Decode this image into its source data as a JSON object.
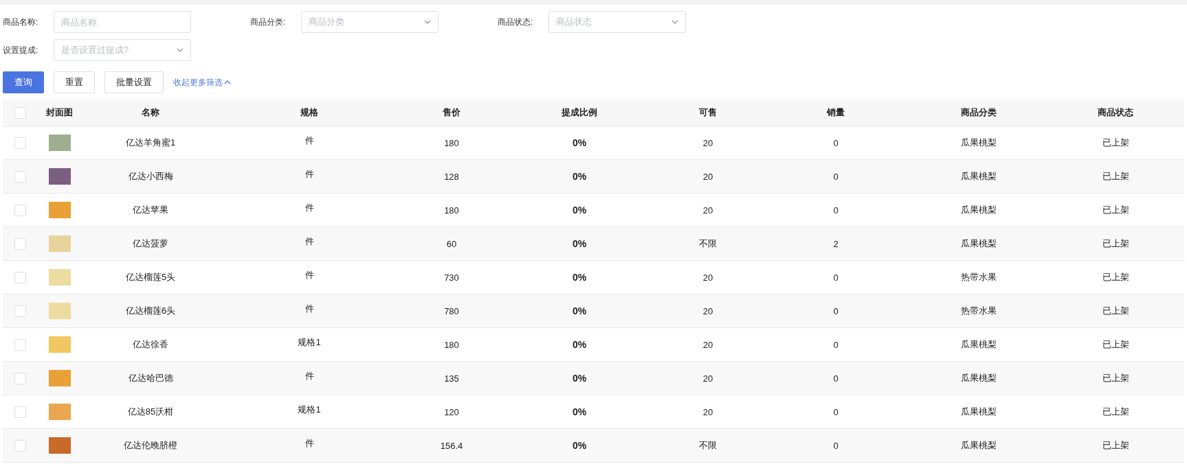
{
  "filters": [
    {
      "kind": "text",
      "label": "商品名称:",
      "placeholder": "商品名称"
    },
    {
      "kind": "select",
      "label": "商品分类:",
      "placeholder": "商品分类"
    },
    {
      "kind": "select",
      "label": "商品状态:",
      "placeholder": "商品状态"
    },
    {
      "kind": "select",
      "label": "设置提成:",
      "placeholder": "是否设置过提成?"
    }
  ],
  "actions": [
    {
      "kind": "primary",
      "label": "查询"
    },
    {
      "kind": "default",
      "label": "重置"
    },
    {
      "kind": "default",
      "label": "批量设置"
    },
    {
      "kind": "link",
      "label": "收起更多筛选"
    }
  ],
  "table": {
    "select_all_checked": false,
    "columns": [
      "封面图",
      "名称",
      "规格",
      "售价",
      "提成比例",
      "可售",
      "销量",
      "商品分类",
      "商品状态"
    ],
    "rows": [
      {
        "checked": false,
        "name": "亿达羊角蜜1",
        "spec": "件",
        "price": "180",
        "ratio": "0%",
        "available": "20",
        "sales": "0",
        "category": "瓜果桃梨",
        "status": "已上架"
      },
      {
        "checked": false,
        "name": "亿达小西梅",
        "spec": "件",
        "price": "128",
        "ratio": "0%",
        "available": "20",
        "sales": "0",
        "category": "瓜果桃梨",
        "status": "已上架"
      },
      {
        "checked": false,
        "name": "亿达苹果",
        "spec": "件",
        "price": "180",
        "ratio": "0%",
        "available": "20",
        "sales": "0",
        "category": "瓜果桃梨",
        "status": "已上架"
      },
      {
        "checked": false,
        "name": "亿达菠萝",
        "spec": "件",
        "price": "60",
        "ratio": "0%",
        "available": "不限",
        "sales": "2",
        "category": "瓜果桃梨",
        "status": "已上架"
      },
      {
        "checked": false,
        "name": "亿达榴莲5头",
        "spec": "件",
        "price": "730",
        "ratio": "0%",
        "available": "20",
        "sales": "0",
        "category": "热带水果",
        "status": "已上架"
      },
      {
        "checked": false,
        "name": "亿达榴莲6头",
        "spec": "件",
        "price": "780",
        "ratio": "0%",
        "available": "20",
        "sales": "0",
        "category": "热带水果",
        "status": "已上架"
      },
      {
        "checked": false,
        "name": "亿达徐香",
        "spec": "规格1",
        "price": "180",
        "ratio": "0%",
        "available": "20",
        "sales": "0",
        "category": "瓜果桃梨",
        "status": "已上架"
      },
      {
        "checked": false,
        "name": "亿达哈巴德",
        "spec": "件",
        "price": "135",
        "ratio": "0%",
        "available": "20",
        "sales": "0",
        "category": "瓜果桃梨",
        "status": "已上架"
      },
      {
        "checked": false,
        "name": "亿达85沃柑",
        "spec": "规格1",
        "price": "120",
        "ratio": "0%",
        "available": "20",
        "sales": "0",
        "category": "瓜果桃梨",
        "status": "已上架"
      },
      {
        "checked": false,
        "name": "亿达伦晚脐橙",
        "spec": "件",
        "price": "156.4",
        "ratio": "0%",
        "available": "不限",
        "sales": "0",
        "category": "瓜果桃梨",
        "status": "已上架"
      }
    ]
  }
}
